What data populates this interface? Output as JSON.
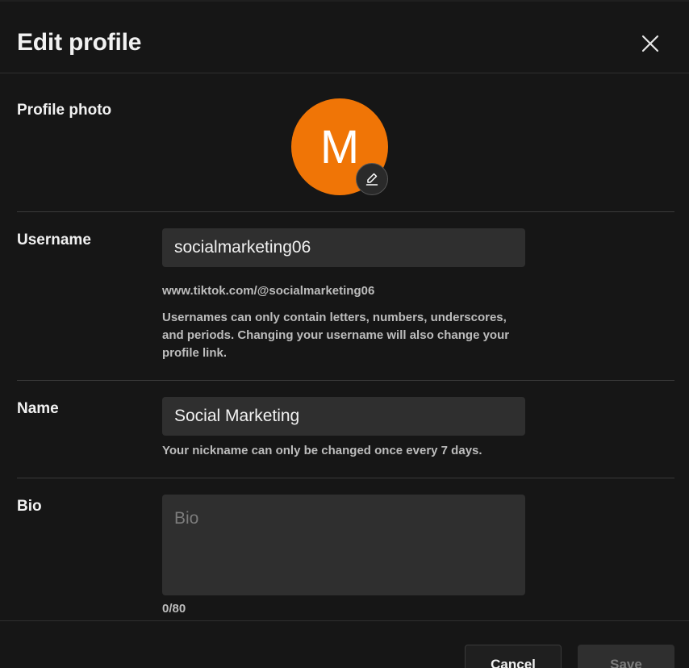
{
  "header": {
    "title": "Edit profile",
    "close_icon": "close-icon"
  },
  "profile_photo": {
    "label": "Profile photo",
    "avatar_letter": "M",
    "avatar_color": "#f07506",
    "edit_icon": "pencil-icon"
  },
  "username": {
    "label": "Username",
    "value": "socialmarketing06",
    "url": "www.tiktok.com/@socialmarketing06",
    "hint": "Usernames can only contain letters, numbers, underscores, and periods. Changing your username will also change your profile link."
  },
  "name": {
    "label": "Name",
    "value": "Social Marketing",
    "hint": "Your nickname can only be changed once every 7 days."
  },
  "bio": {
    "label": "Bio",
    "placeholder": "Bio",
    "value": "",
    "counter": "0/80"
  },
  "footer": {
    "cancel_label": "Cancel",
    "save_label": "Save"
  }
}
